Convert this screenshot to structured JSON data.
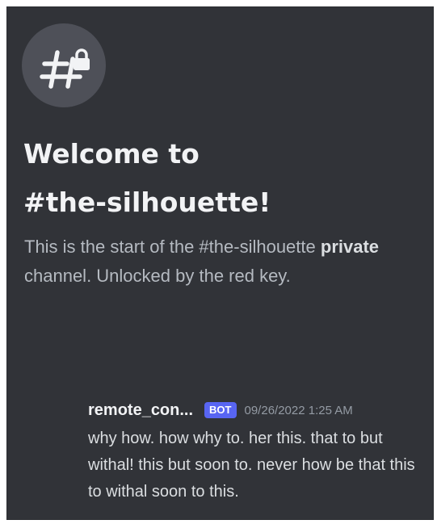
{
  "channel": {
    "icon": "hashtag-lock-icon",
    "welcome_line1": "Welcome to",
    "welcome_line2": "#the-silhouette!",
    "desc_part1": "This is the start of the #the-silhouette",
    "desc_strong": "private",
    "desc_part2": "channel. Unlocked by the red key."
  },
  "message": {
    "author": "remote_con...",
    "bot_tag": "BOT",
    "timestamp": "09/26/2022 1:25 AM",
    "content": "why how. how why to. her this. that to but withal! this but soon to. never how be that this to withal soon to this."
  },
  "colors": {
    "background": "#313338",
    "bot_tag": "#5865f2",
    "icon_circle": "#4e5058"
  }
}
